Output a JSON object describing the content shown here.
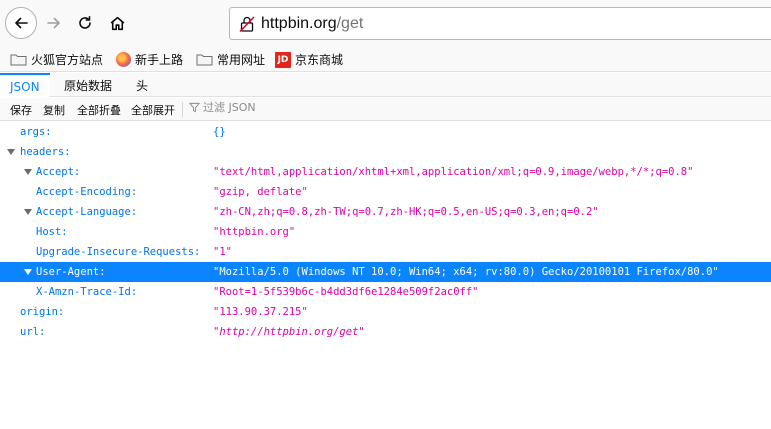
{
  "browser": {
    "url_host": "httpbin.org",
    "url_path": "/get",
    "buttons": {
      "back": "back-arrow-icon",
      "forward": "forward-arrow-icon",
      "reload": "reload-icon",
      "home": "home-icon"
    }
  },
  "bookmarks": [
    {
      "label": "火狐官方站点",
      "icon": "folder-icon"
    },
    {
      "label": "新手上路",
      "icon": "firefox-icon"
    },
    {
      "label": "常用网址",
      "icon": "folder-icon"
    },
    {
      "label": "京东商城",
      "icon": "jd-icon",
      "icon_text": "JD"
    }
  ],
  "viewer_tabs": [
    {
      "label": "JSON",
      "active": true
    },
    {
      "label": "原始数据",
      "active": false
    },
    {
      "label": "头",
      "active": false
    }
  ],
  "toolbar": {
    "save": "保存",
    "copy": "复制",
    "collapse_all": "全部折叠",
    "expand_all": "全部展开",
    "filter_placeholder": "过滤 JSON"
  },
  "json": {
    "rows": [
      {
        "key": "args:",
        "value": "{}"
      },
      {
        "key": "headers:",
        "value": ""
      },
      {
        "key": "Accept:",
        "value": "\"text/html,application/xhtml+xml,application/xml;q=0.9,image/webp,*/*;q=0.8\""
      },
      {
        "key": "Accept-Encoding:",
        "value": "\"gzip, deflate\""
      },
      {
        "key": "Accept-Language:",
        "value": "\"zh-CN,zh;q=0.8,zh-TW;q=0.7,zh-HK;q=0.5,en-US;q=0.3,en;q=0.2\""
      },
      {
        "key": "Host:",
        "value": "\"httpbin.org\""
      },
      {
        "key": "Upgrade-Insecure-Requests:",
        "value": "\"1\""
      },
      {
        "key": "User-Agent:",
        "value": "\"Mozilla/5.0 (Windows NT 10.0; Win64; x64; rv:80.0) Gecko/20100101 Firefox/80.0\"",
        "selected": true
      },
      {
        "key": "X-Amzn-Trace-Id:",
        "value": "\"Root=1-5f539b6c-b4dd3df6e1284e509f2ac0ff\""
      },
      {
        "key": "origin:",
        "value": "\"113.90.37.215\""
      },
      {
        "key": "url:",
        "value": "\"http://httpbin.org/get\""
      }
    ]
  },
  "colors": {
    "accent": "#0a84ff",
    "key": "#0074e8",
    "string": "#dd00a9"
  }
}
